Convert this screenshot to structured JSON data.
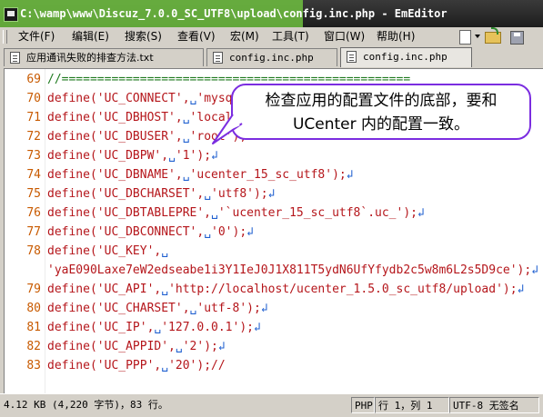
{
  "window": {
    "title": "C:\\wamp\\www\\Discuz_7.0.0_SC_UTF8\\upload\\config.inc.php - EmEditor"
  },
  "menu": {
    "items": [
      "文件(F)",
      "编辑(E)",
      "搜索(S)",
      "查看(V)",
      "宏(M)",
      "工具(T)",
      "窗口(W)",
      "帮助(H)"
    ]
  },
  "toolbar": {
    "icons": [
      "new-file-icon",
      "dropdown-arrow-icon",
      "open-folder-icon",
      "save-icon"
    ]
  },
  "tabs": [
    {
      "label": "应用通讯失败的排查方法.txt",
      "active": false
    },
    {
      "label": "config.inc.php",
      "active": false
    },
    {
      "label": "config.inc.php",
      "active": true
    }
  ],
  "editor": {
    "lines": [
      {
        "num": "69",
        "text": "//=================================================",
        "comment": true
      },
      {
        "num": "70",
        "text": "define('UC_CONNECT',␣'mysql');↲"
      },
      {
        "num": "71",
        "text": "define('UC_DBHOST',␣'localhost');↲"
      },
      {
        "num": "72",
        "text": "define('UC_DBUSER',␣'root');↲"
      },
      {
        "num": "73",
        "text": "define('UC_DBPW',␣'1');↲"
      },
      {
        "num": "74",
        "text": "define('UC_DBNAME',␣'ucenter_15_sc_utf8');↲"
      },
      {
        "num": "75",
        "text": "define('UC_DBCHARSET',␣'utf8');↲"
      },
      {
        "num": "76",
        "text": "define('UC_DBTABLEPRE',␣'`ucenter_15_sc_utf8`.uc_');↲"
      },
      {
        "num": "77",
        "text": "define('UC_DBCONNECT',␣'0');↲"
      },
      {
        "num": "78",
        "text": "define('UC_KEY',␣"
      },
      {
        "num": "",
        "text": "'yaE090Laxe7eW2edseabe1i3Y1IeJ0J1X811T5ydN6UfYfydb2c5w8m6L2s5D9ce');↲"
      },
      {
        "num": "79",
        "text": "define('UC_API',␣'http://localhost/ucenter_1.5.0_sc_utf8/upload');↲"
      },
      {
        "num": "80",
        "text": "define('UC_CHARSET',␣'utf-8');↲"
      },
      {
        "num": "81",
        "text": "define('UC_IP',␣'127.0.0.1');↲"
      },
      {
        "num": "82",
        "text": "define('UC_APPID',␣'2');↲"
      },
      {
        "num": "83",
        "text": "define('UC_PPP',␣'20');//"
      }
    ]
  },
  "callout": {
    "line1": "检查应用的配置文件的底部，要和",
    "line2": "UCenter 内的配置一致。",
    "border_color": "#7b2de0"
  },
  "statusbar": {
    "size": "4.12 KB (4,220 字节)，83 行。",
    "lang": "PHP",
    "position": "行 1，列 1",
    "encoding": "UTF-8 无签名"
  }
}
